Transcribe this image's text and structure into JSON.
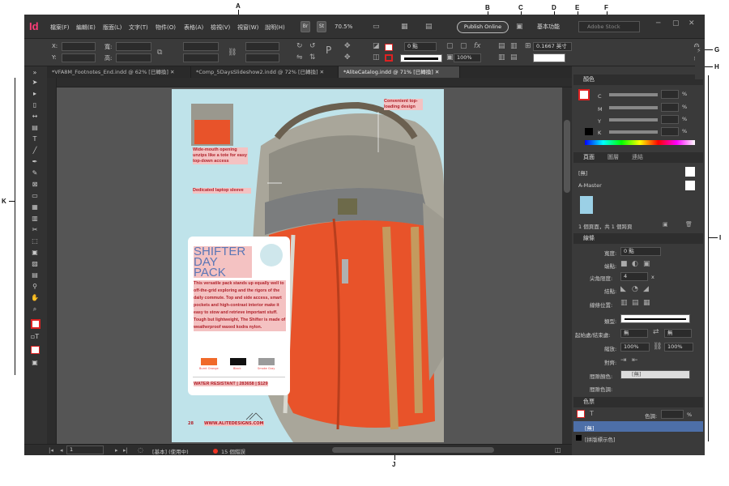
{
  "callouts": {
    "a": "A",
    "b": "B",
    "c": "C",
    "d": "D",
    "e": "E",
    "f": "F",
    "g": "G",
    "h": "H",
    "i": "I",
    "j": "J",
    "k": "K"
  },
  "app": {
    "logo": "Id",
    "menus": [
      "檔案(F)",
      "編輯(E)",
      "版面(L)",
      "文字(T)",
      "物件(O)",
      "表格(A)",
      "檢視(V)",
      "視窗(W)",
      "說明(H)"
    ],
    "bridge": "Br",
    "stock_btn": "St",
    "zoom": "70.5%",
    "publish": "Publish Online",
    "workspace": "基本功能",
    "search_placeholder": "Adobe Stock"
  },
  "control": {
    "x_label": "X:",
    "y_label": "Y:",
    "w_label": "寬:",
    "h_label": "高:",
    "stroke_weight": "0 點",
    "opacity": "100%",
    "ref_value": "0.1667 英寸"
  },
  "tabs": [
    {
      "label": "*VFA8M_Footnotes_End.indd @ 62% [已轉換]"
    },
    {
      "label": "*Comp_5DaysSlideshow2.indd @ 72% [已轉換]"
    },
    {
      "label": "*AliteCatalog.indd @ 71% [已轉換]",
      "active": true
    }
  ],
  "doc": {
    "annot_top": "Convenient top-loading design",
    "annot_open": "Wide-mouth opening unzips like a tote for easy top-down access",
    "annot_laptop": "Dedicated laptop sleeve",
    "title": "SHIFTER DAY PACK",
    "body": "This versatile pack stands up equally well to off-the-grid exploring and the rigors of the daily commute. Top and side access, smart pockets and high-contrast interior make it easy to stow and retrieve important stuff. Tough but lightweight, The Shifter is made of weatherproof waxed kodra nylon.",
    "swatches": [
      {
        "name": "Burnt Orange",
        "color": "#f06a2a"
      },
      {
        "name": "Black",
        "color": "#111111"
      },
      {
        "name": "Smoke Gray",
        "color": "#9a9a9a"
      }
    ],
    "price_line": "WATER RESISTANT | 283658 | $129",
    "page_number": "28",
    "url": "WWW.ALITEDESIGNS.COM"
  },
  "status": {
    "page": "1",
    "master": "[基本] (使用中)",
    "errors": "15 個錯誤"
  },
  "panels": {
    "color": {
      "title": "顏色",
      "channels": [
        "C",
        "M",
        "Y",
        "K"
      ],
      "unit": "%"
    },
    "pages": {
      "tab1": "頁面",
      "tab2": "圖層",
      "tab3": "連結",
      "none": "[無]",
      "master": "A-Master",
      "footer": "1 個頁面，共 1 個跨頁"
    },
    "stroke": {
      "title": "線條",
      "weight_label": "寬度:",
      "weight": "0 點",
      "cap_label": "端點:",
      "miter_label": "尖角限度:",
      "miter": "4",
      "miter_unit": "x",
      "join_label": "結點:",
      "align_label": "線條位置:",
      "type_label": "類型:",
      "startend_label": "起始處/結束處:",
      "start_val": "無",
      "end_val": "無",
      "scale_label": "縮放:",
      "scale1": "100%",
      "scale2": "100%",
      "align2_label": "對齊:",
      "gapcolor_label": "間隙顏色:",
      "gapcolor": "[無]",
      "gaptint_label": "間隙色調:"
    },
    "swatches": {
      "title": "色票",
      "tint_label": "色調:",
      "tint_unit": "%",
      "rows": [
        "[無]",
        "[拼版標示色]"
      ]
    }
  }
}
